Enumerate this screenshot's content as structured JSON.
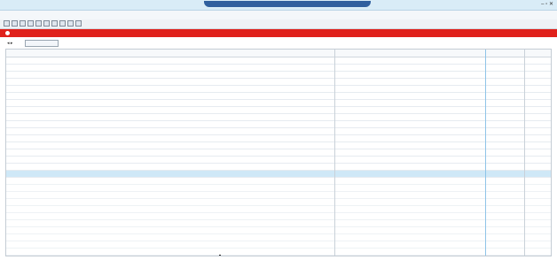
{
  "window": {
    "title": "",
    "controls": "– ▫ ✕"
  },
  "menubar": {
    "items": [
      "",
      "",
      "",
      ""
    ]
  },
  "toolbar": {
    "labels": [
      "",
      ""
    ]
  },
  "alert": {
    "text": ""
  },
  "tabs": {
    "nav": "◂ ▸",
    "active": ""
  },
  "grid": {
    "columns": [
      "",
      "",
      "",
      "",
      "",
      "",
      "",
      "",
      "",
      "",
      "",
      "",
      "",
      "",
      "",
      "",
      ""
    ],
    "rows": [
      [
        "",
        "",
        "",
        "",
        "",
        "",
        "",
        "",
        "",
        "",
        "",
        "",
        "",
        "",
        "",
        "",
        ""
      ],
      [
        "",
        "",
        "",
        "",
        "",
        "",
        "",
        "",
        "",
        "",
        "",
        "",
        "",
        "",
        "",
        "",
        ""
      ],
      [
        "",
        "",
        "",
        "",
        "",
        "",
        "",
        "",
        "",
        "",
        "",
        "",
        "",
        "",
        "",
        "",
        ""
      ],
      [
        "",
        "",
        "",
        "",
        "",
        "",
        "",
        "",
        "",
        "",
        "",
        "",
        "",
        "",
        "",
        "",
        ""
      ],
      [
        "",
        "",
        "",
        "",
        "",
        "",
        "",
        "",
        "",
        "",
        "",
        "",
        "",
        "",
        "",
        "",
        ""
      ],
      [
        "",
        "",
        "",
        "",
        "",
        "",
        "",
        "",
        "",
        "",
        "",
        "",
        "",
        "",
        "",
        "",
        ""
      ],
      [
        "",
        "",
        "",
        "",
        "",
        "",
        "",
        "",
        "",
        "",
        "",
        "",
        "",
        "",
        "",
        "",
        ""
      ],
      [
        "",
        "",
        "",
        "",
        "",
        "",
        "",
        "",
        "",
        "",
        "",
        "",
        "",
        "",
        "",
        "",
        ""
      ],
      [
        "",
        "",
        "",
        "",
        "",
        "",
        "",
        "",
        "",
        "",
        "",
        "",
        "",
        "",
        "",
        "",
        ""
      ],
      [
        "",
        "",
        "",
        "",
        "",
        "",
        "",
        "",
        "",
        "",
        "",
        "",
        "",
        "",
        "",
        "",
        ""
      ],
      [
        "",
        "",
        "",
        "",
        "",
        "",
        "",
        "",
        "",
        "",
        "",
        "",
        "",
        "",
        "",
        "",
        ""
      ],
      [
        "",
        "",
        "",
        "",
        "",
        "",
        "",
        "",
        "",
        "",
        "",
        "",
        "",
        "",
        "",
        "",
        ""
      ],
      [
        "",
        "",
        "",
        "",
        "",
        "",
        "",
        "",
        "",
        "",
        "",
        "",
        "",
        "",
        "",
        "",
        ""
      ],
      [
        "",
        "",
        "",
        "",
        "",
        "",
        "",
        "",
        "",
        "",
        "",
        "",
        "",
        "",
        "",
        "",
        ""
      ],
      [
        "",
        "",
        "",
        "",
        "",
        "",
        "",
        "",
        "",
        "",
        "",
        "",
        "",
        "",
        "",
        "",
        ""
      ],
      [
        "",
        "",
        "",
        "",
        "",
        "",
        "",
        "",
        "",
        "",
        "",
        "",
        "",
        "",
        "",
        "",
        ""
      ],
      [
        "",
        "",
        "",
        "",
        "",
        "",
        "",
        "",
        "",
        "",
        "",
        "",
        "",
        "",
        "",
        "",
        ""
      ]
    ],
    "selected_row": 16
  },
  "colors": {
    "alert_bar": "#e0211b",
    "selection": "#cfe8f7",
    "title_pill": "#2f5f9e"
  }
}
